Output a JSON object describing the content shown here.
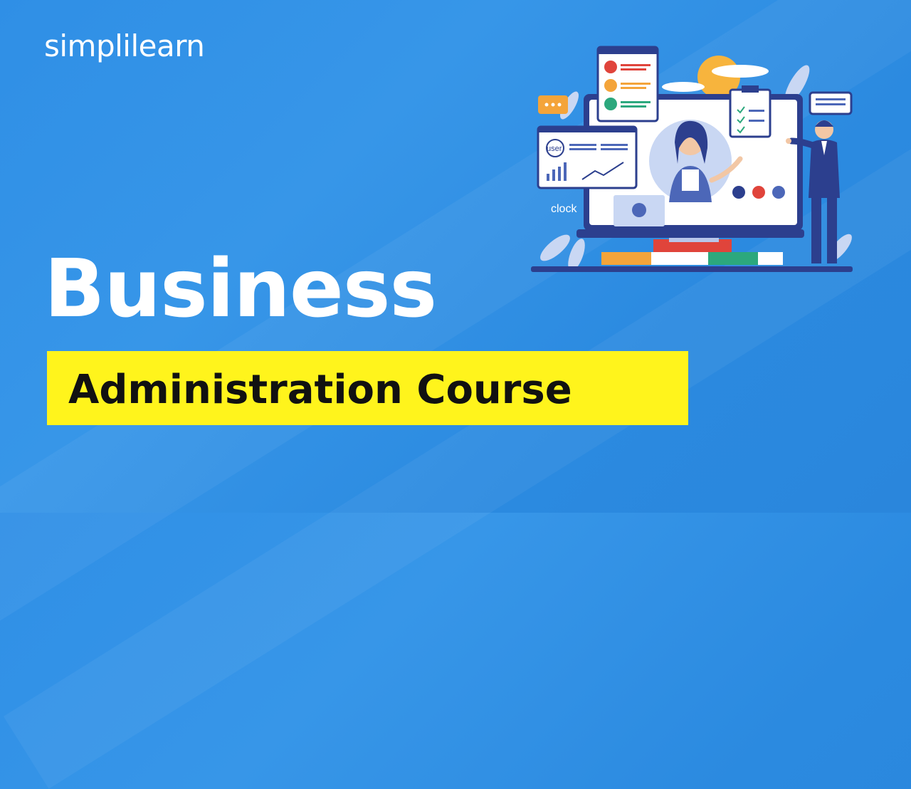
{
  "brand": {
    "name": "simplilearn"
  },
  "title": {
    "line1": "Business",
    "line2": "Administration Course"
  },
  "illustration": {
    "user_label": "user",
    "clock_label": "clock"
  },
  "colors": {
    "background": "#2f8fe6",
    "banner": "#fff41c",
    "title_text": "#ffffff",
    "banner_text": "#111111"
  }
}
